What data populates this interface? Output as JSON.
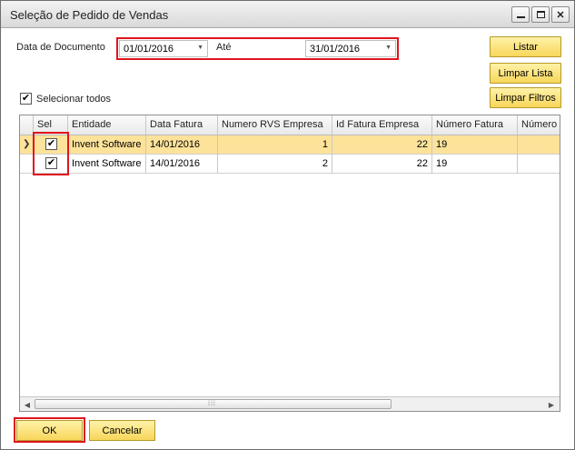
{
  "window": {
    "title": "Seleção de Pedido de Vendas"
  },
  "filters": {
    "data_documento_label": "Data de Documento",
    "date_from": "01/01/2016",
    "ate_label": "Até",
    "date_to": "31/01/2016"
  },
  "buttons": {
    "listar": "Listar",
    "limpar_lista": "Limpar Lista",
    "limpar_filtros": "Limpar Filtros",
    "ok": "OK",
    "cancelar": "Cancelar"
  },
  "select_all": {
    "label": "Selecionar todos",
    "checked": true
  },
  "grid": {
    "columns": [
      "Sel",
      "Entidade",
      "Data Fatura",
      "Numero RVS Empresa",
      "Id Fatura Empresa",
      "Número Fatura",
      "Número C"
    ],
    "rows": [
      {
        "sel": true,
        "entidade": "Invent Software",
        "data_fatura": "14/01/2016",
        "numero_rvs": "1",
        "id_fatura": "22",
        "numero_fatura": "19",
        "numero_c": ""
      },
      {
        "sel": true,
        "entidade": "Invent Software",
        "data_fatura": "14/01/2016",
        "numero_rvs": "2",
        "id_fatura": "22",
        "numero_fatura": "19",
        "numero_c": ""
      }
    ]
  },
  "colors": {
    "highlight": "#e0141e",
    "button": "#f7d65a",
    "selected_row": "#fde29a"
  }
}
